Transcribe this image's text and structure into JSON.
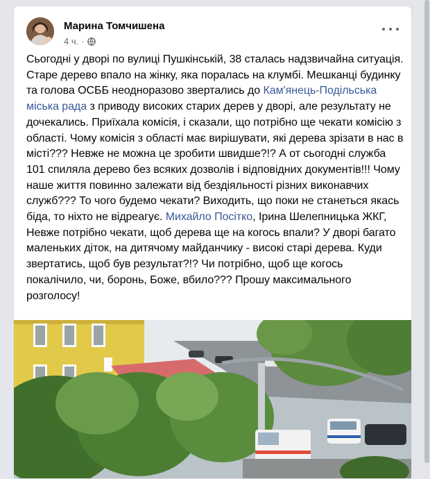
{
  "post": {
    "author": "Марина Томчишена",
    "time": "4 ч.",
    "privacy_icon": "globe-icon",
    "more_icon": "more-options-icon",
    "text": {
      "p1": "Сьогодні у дворі по вулиці Пушкінській, 38 сталась надзвичайна ситуація. Старе дерево впало на жінку, яка поралась на клумбі. Мешканці будинку та голова ОСББ неодноразово звертались до ",
      "link1": "Кам'янець-Подільська міська рада",
      "p2": " з приводу високих старих дерев у дворі, але результату не дочекались. Приїхала комісія, і сказали, що потрібно ще чекати комісію з області. Чому комісія з області має вирішувати, які дерева зрізати в нас в місті??? Невже не можна це зробити швидше?!? А от сьогодні служба 101 спиляла дерево без всяких дозволів і відповідних документів!!! Чому наше життя повинно залежати від бездіяльності різних виконавчих служб??? То чого будемо чекати? Виходить, що поки не станеться якась біда, то ніхто не відреагує. ",
      "link2": "Михайло Посітко",
      "p3": ", Ірина Шелепницька ЖКГ, Невже потрібно чекати, щоб дерева ще на когось впали? У дворі багато маленьких діток, на дитячому майданчику - високі старі дерева. Куди звертатись, щоб був результат?!? Чи потрібно, щоб ще когось покалічило, чи, боронь, Боже, вбило??? Прошу максимального розголосу!"
    }
  },
  "colors": {
    "page_bg": "#e4e6eb",
    "card_bg": "#ffffff",
    "text": "#050505",
    "secondary": "#65676b",
    "link": "#385898"
  }
}
